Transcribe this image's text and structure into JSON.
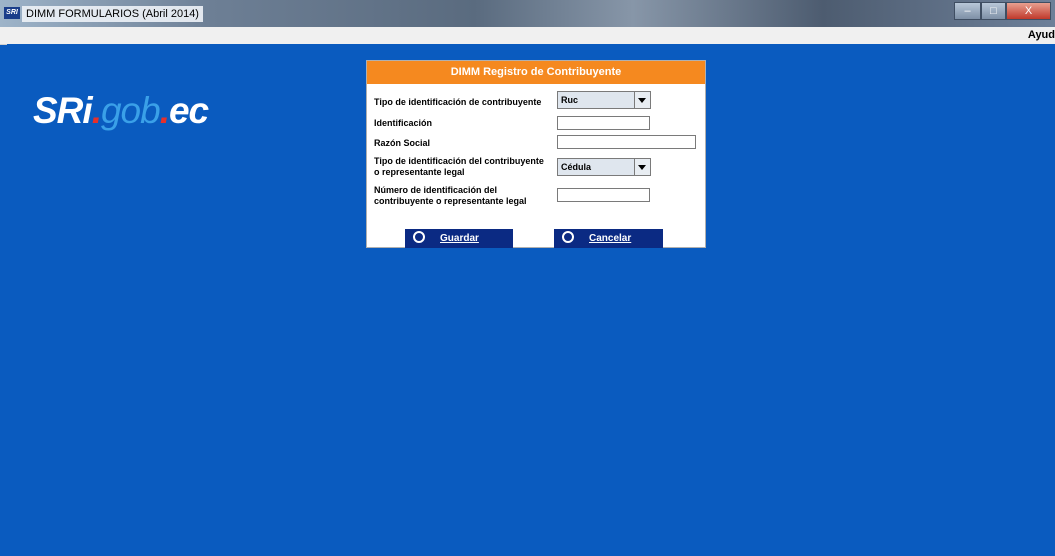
{
  "window": {
    "icon_text": "SRI",
    "title": "DIMM FORMULARIOS (Abril 2014)",
    "controls": {
      "minimize": "–",
      "maximize": "□",
      "close": "X"
    }
  },
  "menu": {
    "help": "Ayud"
  },
  "logo": {
    "sri": "SRi",
    "gob": "gob",
    "dot": ".",
    "ec": "ec"
  },
  "dialog": {
    "title": "DIMM Registro de Contribuyente",
    "fields": {
      "tipo_id_contribuyente": {
        "label": "Tipo de identificación de contribuyente",
        "value": "Ruc"
      },
      "identificacion": {
        "label": "Identificación",
        "value": ""
      },
      "razon_social": {
        "label": "Razón Social",
        "value": ""
      },
      "tipo_id_representante": {
        "label_line1": "Tipo de identificación del contribuyente",
        "label_line2": "o representante legal",
        "value": "Cédula"
      },
      "numero_id_representante": {
        "label_line1": "Número de identificación del",
        "label_line2": "contribuyente o representante legal",
        "value": ""
      }
    },
    "buttons": {
      "save": "Guardar",
      "cancel": "Cancelar"
    }
  },
  "colors": {
    "desktop": "#0a5bbf",
    "dialog_header": "#f5891f",
    "button": "#0b2a83"
  }
}
